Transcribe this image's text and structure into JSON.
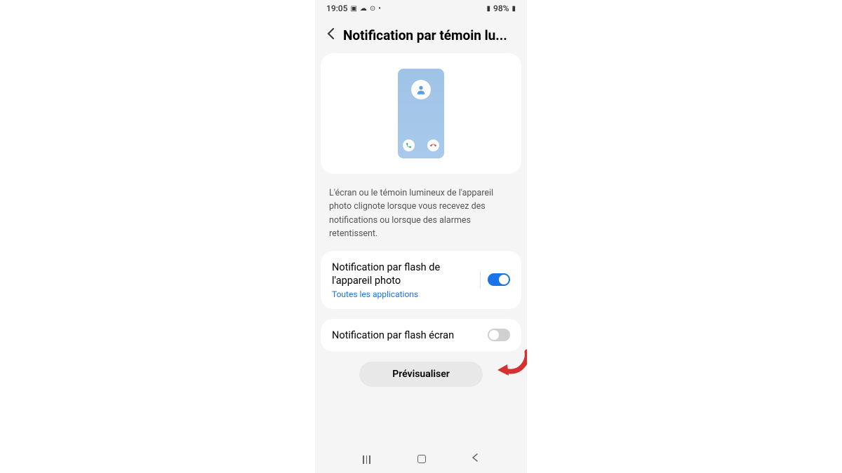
{
  "status_bar": {
    "time": "19:05",
    "battery": "98%"
  },
  "header": {
    "title": "Notification par témoin lu..."
  },
  "description": "L'écran ou le témoin lumineux de l'appareil photo clignote lorsque vous recevez des notifications ou lorsque des alarmes retentissent.",
  "settings": {
    "camera_flash": {
      "title": "Notification par flash de l'appareil photo",
      "subtitle": "Toutes les applications",
      "enabled": true
    },
    "screen_flash": {
      "title": "Notification par flash écran",
      "enabled": false
    }
  },
  "preview_button": "Prévisualiser",
  "colors": {
    "accent": "#1a73e8",
    "arrow": "#d63131"
  }
}
